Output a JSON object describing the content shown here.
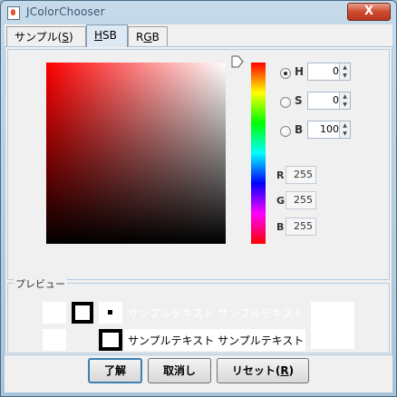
{
  "window": {
    "title": "JColorChooser",
    "close_label": "X"
  },
  "tabs": [
    {
      "label": "サンプル(",
      "mnemonic": "S",
      "suffix": ")"
    },
    {
      "label": "",
      "mnemonic": "H",
      "suffix": "SB"
    },
    {
      "label": "R",
      "mnemonic": "G",
      "suffix": "B"
    }
  ],
  "hsb": {
    "h": {
      "label": "H",
      "value": "0"
    },
    "s": {
      "label": "S",
      "value": "0"
    },
    "b": {
      "label": "B",
      "value": "100"
    },
    "selected": "H"
  },
  "rgb": {
    "r": {
      "label": "R",
      "value": "255"
    },
    "g": {
      "label": "G",
      "value": "255"
    },
    "b": {
      "label": "B",
      "value": "255"
    }
  },
  "preview": {
    "title": "プレビュー",
    "text_top": "サンプルテキスト サンプルテキスト",
    "text_bottom": "サンプルテキスト サンプルテキスト",
    "sample_color": "#ffffff"
  },
  "buttons": {
    "ok": "了解",
    "cancel": "取消し",
    "reset_prefix": "リセット(",
    "reset_mnemonic": "R",
    "reset_suffix": ")"
  },
  "colors": {
    "accent": "#3c7fb1",
    "title_bg": "#c6dbea"
  }
}
